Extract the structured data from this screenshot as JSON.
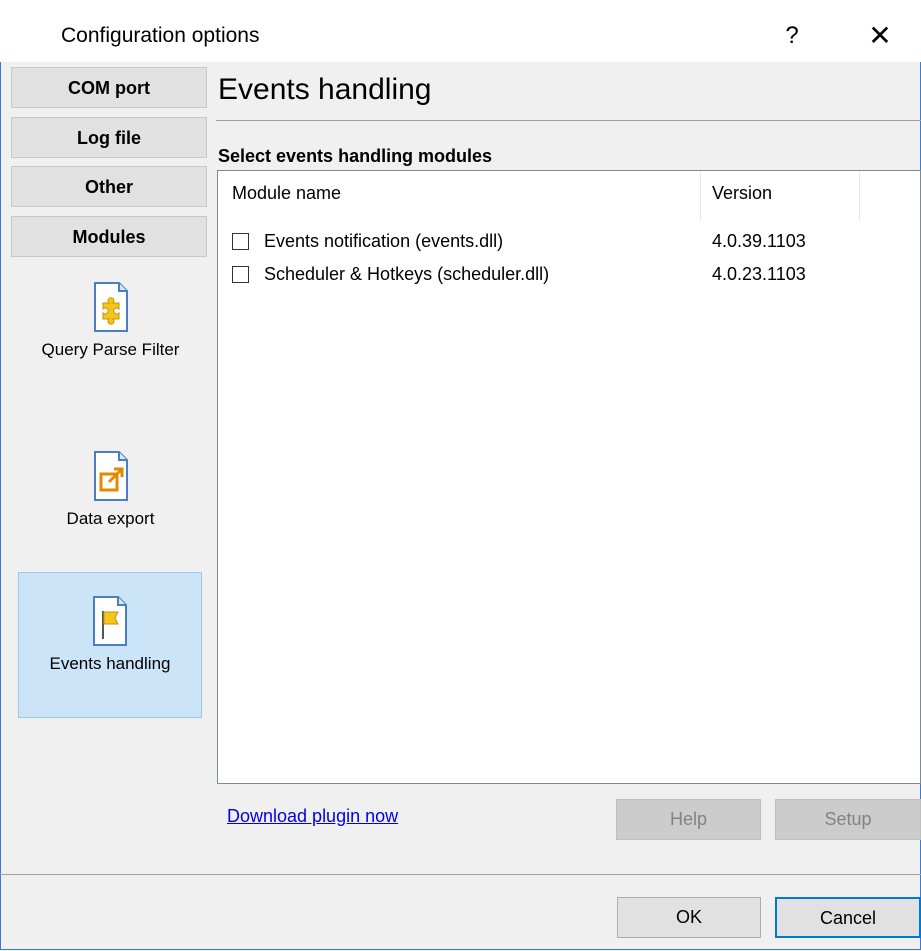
{
  "window": {
    "title": "Configuration options",
    "help_glyph": "?",
    "close_glyph": "✕"
  },
  "sidebar": {
    "categories": [
      "COM port",
      "Log file",
      "Other",
      "Modules"
    ],
    "modules": [
      {
        "label": "Query Parse Filter",
        "icon": "puzzle-document-icon",
        "selected": false
      },
      {
        "label": "Data export",
        "icon": "export-document-icon",
        "selected": false
      },
      {
        "label": "Events handling",
        "icon": "flag-document-icon",
        "selected": true
      }
    ]
  },
  "main": {
    "heading": "Events handling",
    "subheading": "Select events handling modules",
    "columns": [
      "Module name",
      "Version"
    ],
    "rows": [
      {
        "name": "Events notification (events.dll)",
        "version": "4.0.39.1103",
        "checked": false
      },
      {
        "name": "Scheduler & Hotkeys (scheduler.dll)",
        "version": "4.0.23.1103",
        "checked": false
      }
    ],
    "download_link": "Download plugin now",
    "help_label": "Help",
    "setup_label": "Setup"
  },
  "footer": {
    "ok_label": "OK",
    "cancel_label": "Cancel"
  },
  "colors": {
    "selected_bg": "#cce4f7",
    "accent": "#0078d7",
    "link": "#0000ee"
  }
}
